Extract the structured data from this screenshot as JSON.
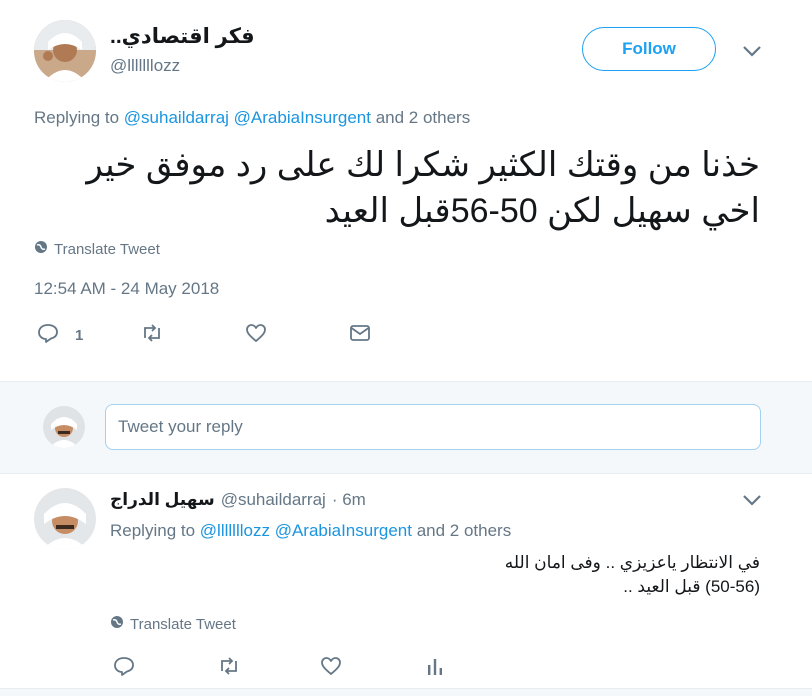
{
  "tweet": {
    "display_name": "فكر اقتصادي..",
    "handle": "@lllllllozz",
    "follow_label": "Follow",
    "replying_prefix": "Replying to",
    "replying_user1": "@suhaildarraj",
    "replying_user2": "@ArabiaInsurgent",
    "replying_suffix": "and 2 others",
    "text_line1": "خذنا من وقتك الكثير شكرا لك على رد موفق خير",
    "text_line2": "اخي سهيل لكن 50-56قبل العيد",
    "translate_label": "Translate Tweet",
    "timestamp": "12:54 AM - 24 May 2018",
    "reply_count": "1"
  },
  "composer": {
    "placeholder": "Tweet your reply"
  },
  "reply": {
    "display_name": "سهيل الدراج",
    "handle": "@suhaildarraj",
    "time": "· 6m",
    "replying_prefix": "Replying to",
    "replying_user1": "@lllllllozz",
    "replying_user2": "@ArabiaInsurgent",
    "replying_suffix": "and 2 others",
    "text_line1": "في الانتظار ياعزيزي .. وفى امان الله",
    "text_line2": "(50-56) قبل العيد ..",
    "translate_label": "Translate Tweet"
  },
  "icons": [
    "avatar",
    "chevron-down-icon",
    "globe-icon",
    "reply-icon",
    "retweet-icon",
    "like-icon",
    "dm-icon",
    "analytics-icon"
  ],
  "colors": {
    "accent": "#1da1f2",
    "link": "#1b95e0",
    "muted": "#657786",
    "band": "#f5f8fa"
  }
}
